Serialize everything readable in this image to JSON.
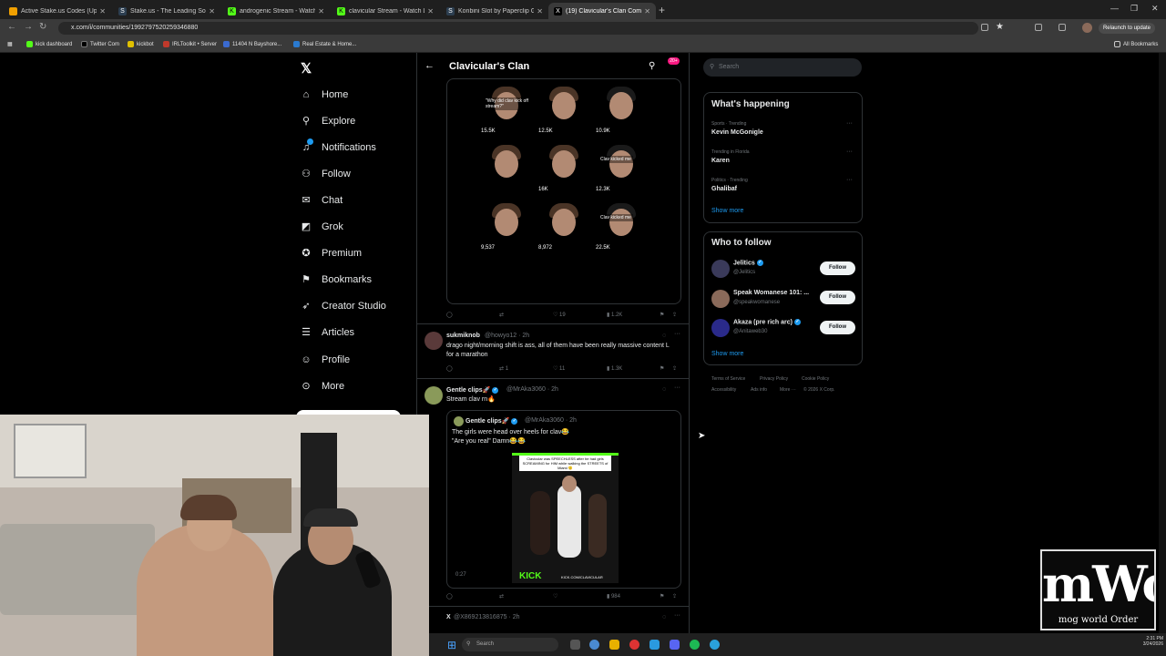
{
  "browser": {
    "tabs": [
      {
        "title": "Active Stake.us Codes (Updated",
        "color": "#f0a000"
      },
      {
        "title": "Stake.us - The Leading Social C",
        "color": "#2c3e50"
      },
      {
        "title": "androgenic Stream - Watch Live",
        "color": "#53fc18"
      },
      {
        "title": "clavicular Stream - Watch Live -",
        "color": "#53fc18"
      },
      {
        "title": "Konbini Slot by Paperclip Gam",
        "color": "#2c3e50"
      },
      {
        "title": "(19) Clavicular's Clan Commun",
        "color": "#000000"
      }
    ],
    "url": "x.com/i/communities/1992797520259346880",
    "relaunch_label": "Relaunch to update",
    "bookmarks": [
      "kick dashboard",
      "Twitter Com",
      "kickbot",
      "IRLToolkit • Server",
      "11404 N Bayshore...",
      "Real Estate & Home..."
    ],
    "all_bookmarks": "All Bookmarks"
  },
  "nav": {
    "items": [
      {
        "label": "Home",
        "icon": "home-icon"
      },
      {
        "label": "Explore",
        "icon": "search-icon"
      },
      {
        "label": "Notifications",
        "icon": "bell-icon"
      },
      {
        "label": "Follow",
        "icon": "follow-icon"
      },
      {
        "label": "Chat",
        "icon": "mail-icon"
      },
      {
        "label": "Grok",
        "icon": "grok-icon"
      },
      {
        "label": "Premium",
        "icon": "premium-icon"
      },
      {
        "label": "Bookmarks",
        "icon": "bookmark-icon"
      },
      {
        "label": "Creator Studio",
        "icon": "rocket-icon"
      },
      {
        "label": "Articles",
        "icon": "articles-icon"
      },
      {
        "label": "Profile",
        "icon": "person-icon"
      },
      {
        "label": "More",
        "icon": "more-icon"
      }
    ]
  },
  "header": {
    "title": "Clavicular's Clan",
    "badge": "20+"
  },
  "grid": {
    "thumbs": [
      {
        "caption": "\"Why did clav kick off stream?\"",
        "views": "15.5K"
      },
      {
        "caption": "",
        "views": "12.5K"
      },
      {
        "caption": "",
        "views": "10.9K"
      },
      {
        "caption": "",
        "views": ""
      },
      {
        "caption": "",
        "views": "16K"
      },
      {
        "caption": "Clav kicked me",
        "views": "12.3K"
      },
      {
        "caption": "",
        "views": "9,537"
      },
      {
        "caption": "",
        "views": "8,972"
      },
      {
        "caption": "Clav kicked me",
        "views": "22.5K"
      }
    ],
    "actions": {
      "likes": "19",
      "views": "1.2K"
    }
  },
  "post1": {
    "name": "sukmiknob",
    "handle": "@howyo12 · 2h",
    "text": "drago night/morning shift is ass, all of them have been really massive content L for a marathon",
    "reposts": "1",
    "likes": "11",
    "views": "1.3K"
  },
  "post2": {
    "name": "Gentle clips🚀",
    "handle": "@MrAka3060 · 2h",
    "text": "Stream clav rn🔥",
    "quote_name": "Gentle clips🚀",
    "quote_handle": "@MrAka3060 · 2h",
    "quote_text1": "The girls were head over heels for clav😂",
    "quote_text2": "\"Are you real\" Damn😂😂",
    "video_caption": "Clavicular was SPEECHLESS after he had girls SCREAMING for HIM while walking the STREETS of Miami 😮‍💨",
    "video_brand": "KICK",
    "video_handle": "KICK.COM/CLAVICULAR",
    "duration": "0:27",
    "views": "984"
  },
  "post3": {
    "name": "X",
    "handle": "@X869213816875 · 2h"
  },
  "right": {
    "search_placeholder": "Search",
    "happening_title": "What's happening",
    "trends": [
      {
        "meta": "Sports · Trending",
        "name": "Kevin McGonigle"
      },
      {
        "meta": "Trending in Florida",
        "name": "Karen"
      },
      {
        "meta": "Politics · Trending",
        "name": "Ghalibaf"
      }
    ],
    "show_more": "Show more",
    "follow_title": "Who to follow",
    "follow": [
      {
        "name": "Jelitics",
        "handle": "@Jelitics",
        "color": "#3a3a5a"
      },
      {
        "name": "Speak Womanese 101: ...",
        "handle": "@speakwomanese",
        "color": "#8a6a5a"
      },
      {
        "name": "Akaza (pre rich arc)",
        "handle": "@Anitaweb30",
        "color": "#2a2a8a"
      }
    ],
    "follow_label": "Follow",
    "footer1": [
      "Terms of Service",
      "Privacy Policy",
      "Cookie Policy"
    ],
    "footer2": [
      "Accessibility",
      "Ads info",
      "More ···",
      "© 2026 X Corp."
    ]
  },
  "taskbar": {
    "search_placeholder": "Search",
    "time": "2:31 PM",
    "date": "3/24/2026"
  },
  "overlay": {
    "logo_text": "mWo",
    "logo_sub": "mog world Order"
  },
  "colors": {
    "accent": "#1d9bf0",
    "kick": "#53fc18",
    "pink_badge": "#f91880"
  }
}
